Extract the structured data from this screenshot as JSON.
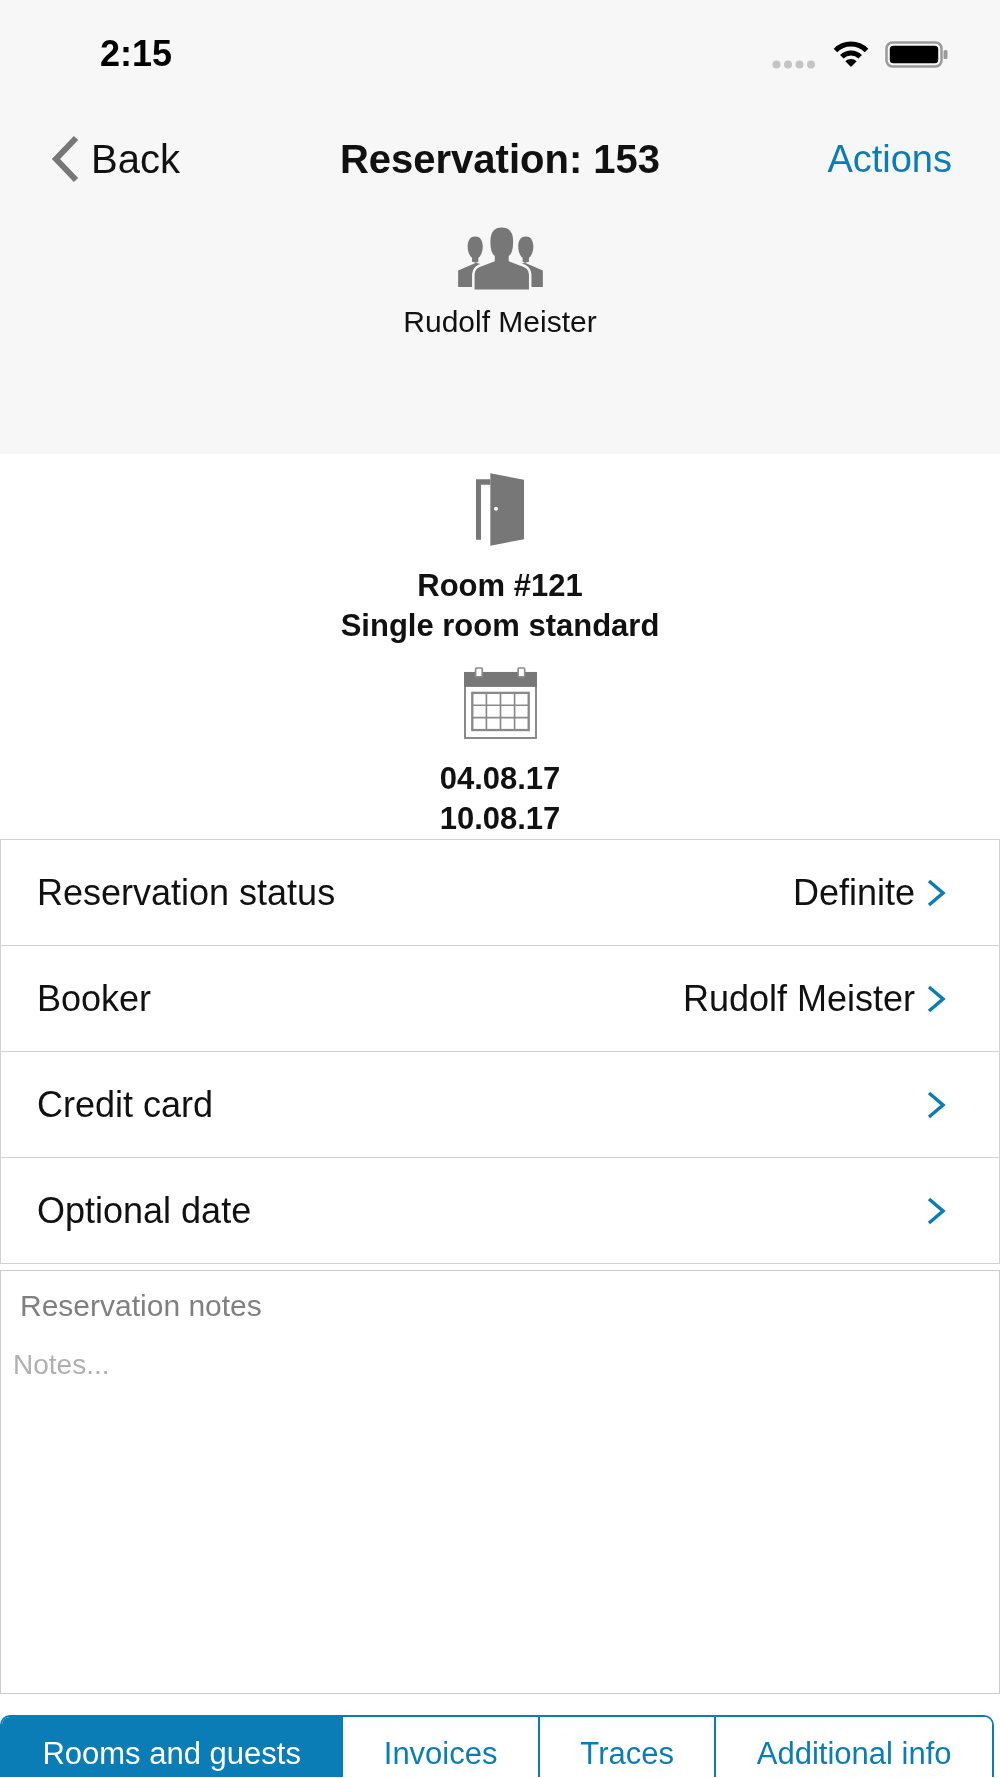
{
  "status_bar": {
    "time": "2:15"
  },
  "nav_bar": {
    "back_label": "Back",
    "title": "Reservation: 153",
    "action_label": "Actions"
  },
  "guest": {
    "name": "Rudolf Meister"
  },
  "room": {
    "number": "Room #121",
    "type": "Single room standard"
  },
  "stay": {
    "arrival": "04.08.17",
    "departure": "10.08.17"
  },
  "details": [
    {
      "label": "Reservation status",
      "value": "Definite"
    },
    {
      "label": "Booker",
      "value": "Rudolf Meister"
    },
    {
      "label": "Credit card"
    },
    {
      "label": "Optional date"
    }
  ],
  "notes": {
    "label": "Reservation notes",
    "placeholder": "Notes..."
  },
  "tabs": [
    {
      "label": "Rooms and guests",
      "selected": true
    },
    {
      "label": "Invoices",
      "selected": false
    },
    {
      "label": "Traces",
      "selected": false
    },
    {
      "label": "Additional info",
      "selected": false
    }
  ]
}
